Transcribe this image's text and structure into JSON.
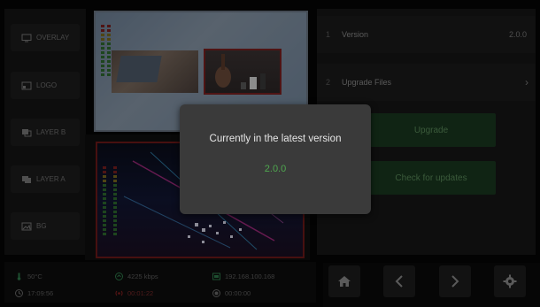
{
  "sidebar": {
    "items": [
      {
        "label": "OVERLAY",
        "icon": "monitor-icon"
      },
      {
        "label": "LOGO",
        "icon": "image-frame-icon"
      },
      {
        "label": "LAYER B",
        "icon": "layers-icon"
      },
      {
        "label": "LAYER A",
        "icon": "layers-icon"
      },
      {
        "label": "BG",
        "icon": "picture-icon"
      }
    ]
  },
  "settings": {
    "rows": [
      {
        "num": "1",
        "label": "Version",
        "value": "2.0.0"
      },
      {
        "num": "2",
        "label": "Upgrade Files",
        "chevron": "›"
      }
    ],
    "upgrade_label": "Upgrade",
    "check_label": "Check for updates"
  },
  "status": {
    "temperature": "50°C",
    "bitrate": "4225 kbps",
    "ip": "192.168.100.168",
    "clock": "17:09:56",
    "live_time": "00:01:22",
    "record_time": "00:00:00"
  },
  "nav": {
    "home": "home-icon",
    "prev": "chevron-left-icon",
    "next": "chevron-right-icon",
    "settings": "gear-icon"
  },
  "dialog": {
    "title": "Currently in the latest version",
    "version": "2.0.0"
  },
  "colors": {
    "accent_green": "#4fa84f",
    "button_green": "#1a3820",
    "record_red": "#8a2020"
  }
}
